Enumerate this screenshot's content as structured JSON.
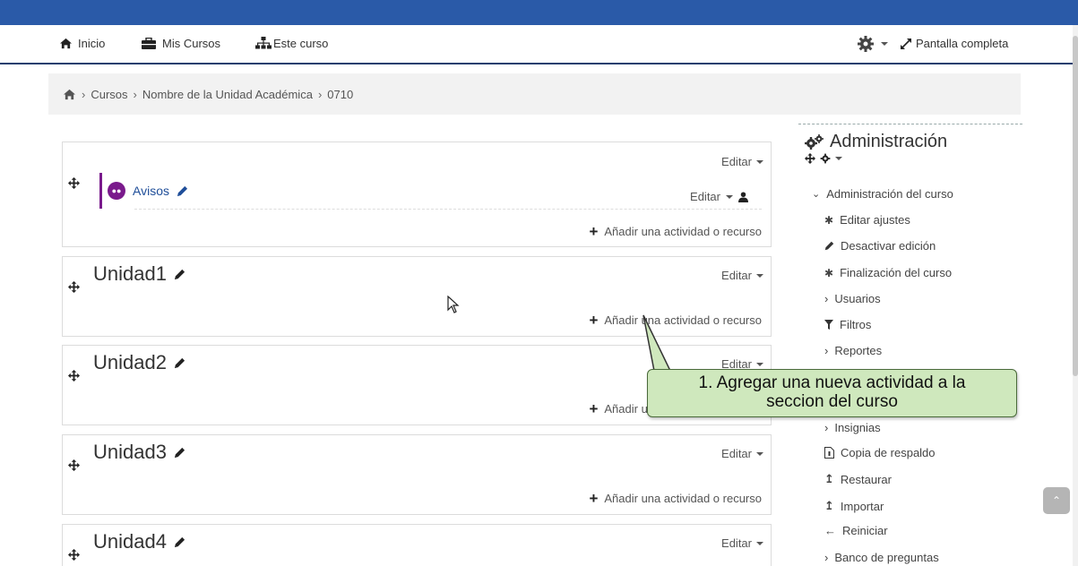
{
  "nav": {
    "home_label": "Inicio",
    "my_courses_label": "Mis Cursos",
    "this_course_label": "Este curso",
    "fullscreen_label": "Pantalla completa"
  },
  "breadcrumb": {
    "items": [
      "Cursos",
      "Nombre de la Unidad Académica",
      "0710"
    ]
  },
  "sections": {
    "announcements": {
      "edit_label": "Editar",
      "activity_name": "Avisos",
      "activity_edit_label": "Editar",
      "add_label": "Añadir una actividad o recurso"
    },
    "units": [
      {
        "title": "Unidad1",
        "edit_label": "Editar",
        "add_label": "Añadir una actividad o recurso"
      },
      {
        "title": "Unidad2",
        "edit_label": "Editar",
        "add_label": "Añadir una actividad o recurso"
      },
      {
        "title": "Unidad3",
        "edit_label": "Editar",
        "add_label": "Añadir una actividad o recurso"
      },
      {
        "title": "Unidad4",
        "edit_label": "Editar"
      }
    ]
  },
  "admin": {
    "title": "Administración",
    "course_admin_label": "Administración del curso",
    "items": [
      "Editar ajustes",
      "Desactivar edición",
      "Finalización del curso",
      "Usuarios",
      "Filtros",
      "Reportes",
      "Insignias",
      "Copia de respaldo",
      "Restaurar",
      "Importar",
      "Reiniciar",
      "Banco de preguntas"
    ]
  },
  "callout": {
    "line1": "1. Agregar una nueva actividad a la",
    "line2": "seccion del curso"
  },
  "colors": {
    "top_bar": "#2a5aa8",
    "link": "#1f4e99",
    "announcements_accent": "#7a1a8c",
    "callout_bg": "#cfe8bd"
  }
}
